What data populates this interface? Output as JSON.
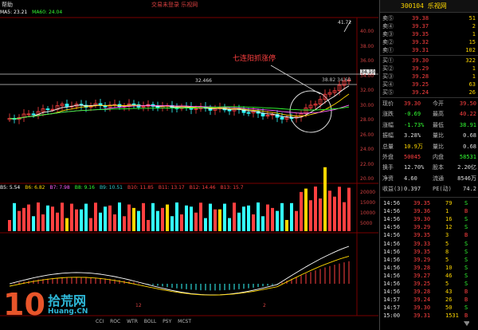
{
  "header": {
    "app_name": "帮助",
    "title": "交易未登录  乐视网",
    "ma_line": [
      {
        "label": "MA5: 23.21",
        "color": "#ffffff"
      },
      {
        "label": "MA60: 24.04",
        "color": "#33ff33"
      }
    ]
  },
  "annotations": {
    "pattern_label": "七连阳抓涨停",
    "level_left": "32.466",
    "price_high": "41.72",
    "price_line_right": "34.10",
    "mid_line_label": "38.82 34.60"
  },
  "main_axis": {
    "labels": [
      "40.00",
      "38.00",
      "36.00",
      "34.00",
      "32.00",
      "30.00",
      "28.00",
      "26.00",
      "24.00",
      "22.00",
      "20.00"
    ]
  },
  "indicator_bar": {
    "labels": [
      "B5: 5.54",
      "B6: 6.82",
      "B7: 7.98",
      "B8: 9.16",
      "B9: 10.51",
      "B10: 11.85",
      "B11: 13.17",
      "B12: 14.46",
      "B13: 15.7"
    ],
    "colors": [
      "#ffffff",
      "#ffd700",
      "#ff60ff",
      "#33ff33",
      "#33cccc",
      "#ff4040",
      "#ff4040",
      "#ff4040",
      "#ff4040"
    ]
  },
  "volume_axis": {
    "labels": [
      "20000",
      "15000",
      "10000",
      "5000"
    ]
  },
  "date_labels": {
    "a": "12",
    "b": "2"
  },
  "bottom_tabs": [
    "CCI",
    "ROC",
    "WTR",
    "BOLL",
    "PSY",
    "MCST"
  ],
  "watermark": {
    "number": "10",
    "cn": "拾荒网",
    "url": "Huang.CN"
  },
  "panel": {
    "code": "300104 乐视网",
    "asks": [
      {
        "label": "卖⑤",
        "price": "39.38",
        "vol": "51"
      },
      {
        "label": "卖④",
        "price": "39.37",
        "vol": "2"
      },
      {
        "label": "卖③",
        "price": "39.35",
        "vol": "1"
      },
      {
        "label": "卖②",
        "price": "39.32",
        "vol": "15"
      },
      {
        "label": "卖①",
        "price": "39.31",
        "vol": "102"
      }
    ],
    "bids": [
      {
        "label": "买①",
        "price": "39.30",
        "vol": "322"
      },
      {
        "label": "买②",
        "price": "39.29",
        "vol": "1"
      },
      {
        "label": "买③",
        "price": "39.28",
        "vol": "1"
      },
      {
        "label": "买④",
        "price": "39.25",
        "vol": "63"
      },
      {
        "label": "买⑤",
        "price": "39.24",
        "vol": "26"
      }
    ],
    "stats": [
      {
        "k1": "现价",
        "v1": "39.30",
        "k2": "今开",
        "v2": "39.50",
        "c1": "#ff4040",
        "c2": "#ff4040"
      },
      {
        "k1": "涨跌",
        "v1": "-0.69",
        "k2": "最高",
        "v2": "40.22",
        "c1": "#33ff33",
        "c2": "#ff4040"
      },
      {
        "k1": "涨幅",
        "v1": "-1.73%",
        "k2": "最低",
        "v2": "38.91",
        "c1": "#33ff33",
        "c2": "#33ff33"
      },
      {
        "k1": "振幅",
        "v1": "3.28%",
        "k2": "量比",
        "v2": "0.68",
        "c1": "#ddd",
        "c2": "#ddd"
      },
      {
        "k1": "总量",
        "v1": "10.9万",
        "k2": "量比",
        "v2": "0.68",
        "c1": "#ffd700",
        "c2": "#ddd"
      },
      {
        "k1": "外盘",
        "v1": "50045",
        "k2": "内盘",
        "v2": "58531",
        "c1": "#ff4040",
        "c2": "#33ff33"
      },
      {
        "k1": "换手",
        "v1": "12.70%",
        "k2": "股本",
        "v2": "2.20亿",
        "c1": "#ddd",
        "c2": "#ddd"
      },
      {
        "k1": "净资",
        "v1": "4.60",
        "k2": "流通",
        "v2": "8546万",
        "c1": "#ddd",
        "c2": "#ddd"
      },
      {
        "k1": "收益(3)",
        "v1": "0.397",
        "k2": "PE(动)",
        "v2": "74.2",
        "c1": "#ddd",
        "c2": "#ddd"
      }
    ],
    "ticks": [
      {
        "time": "14:56",
        "price": "39.35",
        "vol": "79",
        "flag": "S"
      },
      {
        "time": "14:56",
        "price": "39.36",
        "vol": "1",
        "flag": "B"
      },
      {
        "time": "14:56",
        "price": "39.30",
        "vol": "16",
        "flag": "S"
      },
      {
        "time": "14:56",
        "price": "39.29",
        "vol": "12",
        "flag": "S"
      },
      {
        "time": "14:56",
        "price": "39.35",
        "vol": "3",
        "flag": "B"
      },
      {
        "time": "14:56",
        "price": "39.33",
        "vol": "5",
        "flag": "S"
      },
      {
        "time": "14:56",
        "price": "39.35",
        "vol": "8",
        "flag": "S"
      },
      {
        "time": "14:56",
        "price": "39.29",
        "vol": "5",
        "flag": "S"
      },
      {
        "time": "14:56",
        "price": "39.28",
        "vol": "10",
        "flag": "S"
      },
      {
        "time": "14:56",
        "price": "39.27",
        "vol": "46",
        "flag": "S"
      },
      {
        "time": "14:56",
        "price": "39.25",
        "vol": "5",
        "flag": "S"
      },
      {
        "time": "14:56",
        "price": "39.28",
        "vol": "43",
        "flag": "B"
      },
      {
        "time": "14:57",
        "price": "39.24",
        "vol": "26",
        "flag": "B"
      },
      {
        "time": "14:57",
        "price": "39.30",
        "vol": "50",
        "flag": "S"
      },
      {
        "time": "15:00",
        "price": "39.31",
        "vol": "1531",
        "flag": "B"
      }
    ]
  },
  "colors": {
    "up": "#ff4040",
    "down": "#33ffff",
    "panel_code": "#ffd700"
  }
}
